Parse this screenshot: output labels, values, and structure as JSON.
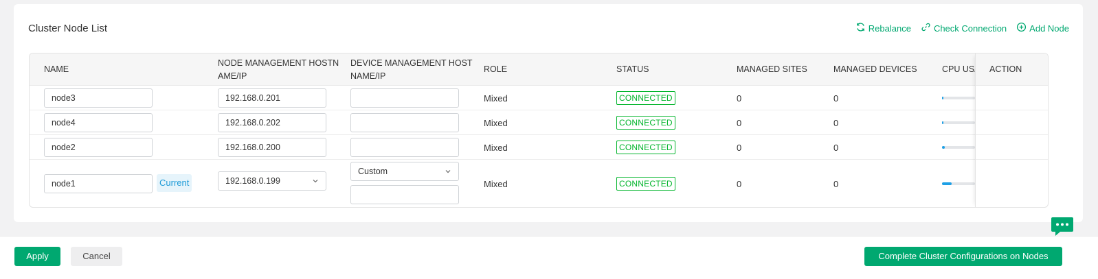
{
  "card": {
    "title": "Cluster Node List",
    "actions": [
      {
        "label": "Rebalance",
        "icon": "refresh-icon"
      },
      {
        "label": "Check Connection",
        "icon": "link-icon"
      },
      {
        "label": "Add Node",
        "icon": "plus-circle-icon"
      }
    ]
  },
  "table": {
    "headers": {
      "name": "NAME",
      "node_mgmt_line1": "NODE MANAGEMENT HOSTN",
      "node_mgmt_line2": "AME/IP",
      "device_mgmt_line1": "DEVICE MANAGEMENT HOST",
      "device_mgmt_line2": "NAME/IP",
      "role": "ROLE",
      "status": "STATUS",
      "managed_sites": "MANAGED SITES",
      "managed_devices": "MANAGED DEVICES",
      "cpu_usage": "CPU USA",
      "action": "ACTION"
    },
    "rows": [
      {
        "name": "node3",
        "node_ip": "192.168.0.201",
        "device_host": "",
        "role": "Mixed",
        "status": "CONNECTED",
        "sites": "0",
        "devices": "0",
        "cpu": 0.03
      },
      {
        "name": "node4",
        "node_ip": "192.168.0.202",
        "device_host": "",
        "role": "Mixed",
        "status": "CONNECTED",
        "sites": "0",
        "devices": "0",
        "cpu": 0.03
      },
      {
        "name": "node2",
        "node_ip": "192.168.0.200",
        "device_host": "",
        "role": "Mixed",
        "status": "CONNECTED",
        "sites": "0",
        "devices": "0",
        "cpu": 0.08
      },
      {
        "name": "node1",
        "current_tag": "Current",
        "node_ip": "192.168.0.199",
        "device_mode": "Custom",
        "device_host": "",
        "role": "Mixed",
        "status": "CONNECTED",
        "sites": "0",
        "devices": "0",
        "cpu": 0.3
      }
    ]
  },
  "footer": {
    "apply": "Apply",
    "cancel": "Cancel",
    "complete": "Complete Cluster Configurations on Nodes"
  },
  "colors": {
    "accent": "#00a870",
    "status_connected": "#00b42a",
    "current_tag_text": "#1e9bd7",
    "cpu_bar": "#1ea0e6"
  }
}
